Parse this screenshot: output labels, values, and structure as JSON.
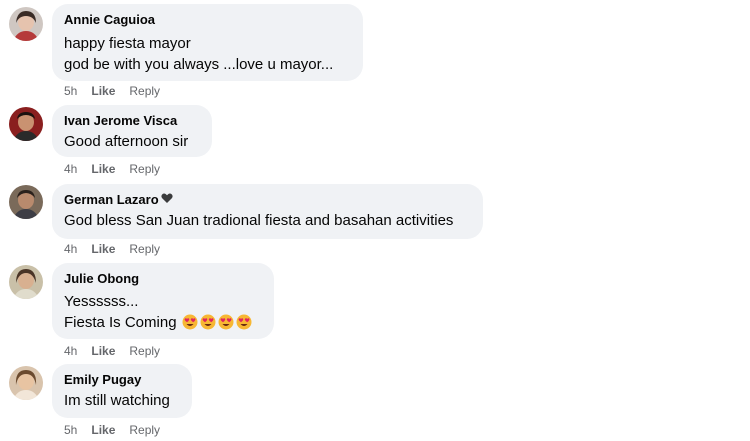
{
  "comments": [
    {
      "author": "Annie Caguioa",
      "lines": [
        "happy fiesta mayor",
        "god be with you always ...love u mayor..."
      ],
      "time": "5h",
      "like": "Like",
      "reply": "Reply"
    },
    {
      "author": "Ivan Jerome Visca",
      "lines": [
        "Good afternoon sir"
      ],
      "time": "4h",
      "like": "Like",
      "reply": "Reply"
    },
    {
      "author": "German Lazaro",
      "lines": [
        "God bless San Juan tradional fiesta and basahan activities"
      ],
      "time": "4h",
      "like": "Like",
      "reply": "Reply"
    },
    {
      "author": "Julie Obong",
      "lines": [
        "Yessssss...",
        "Fiesta Is Coming"
      ],
      "emoji_count": 4,
      "time": "4h",
      "like": "Like",
      "reply": "Reply"
    },
    {
      "author": "Emily Pugay",
      "lines": [
        "Im still watching"
      ],
      "time": "5h",
      "like": "Like",
      "reply": "Reply"
    }
  ],
  "icons": {
    "heart_eyes_emoji": "heart-eyes-emoji",
    "badge": "heart-badge-icon"
  },
  "colors": {
    "bubble_bg": "#f0f2f5",
    "meta_text": "#65676b",
    "text": "#050505"
  }
}
